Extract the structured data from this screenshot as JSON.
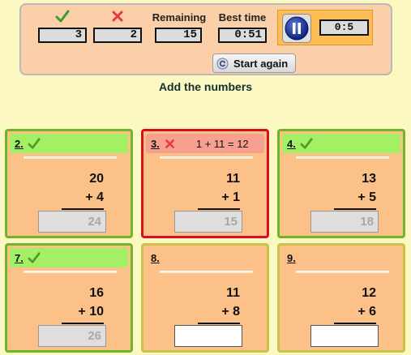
{
  "scoreboard": {
    "correct_count": "3",
    "wrong_count": "2",
    "remaining_label": "Remaining",
    "remaining": "15",
    "best_time_label": "Best time",
    "best_time": "0:51",
    "timer": "0:5",
    "start_again_label": "Start again"
  },
  "colors": {
    "correct": "#6fb52a",
    "wrong": "#d8101d",
    "unanswered": "#cbc24a"
  },
  "instruction": "Add the numbers",
  "problems": [
    {
      "num": "2.",
      "a": "20",
      "b": "+ 4",
      "answer": "24",
      "status": "correct",
      "feedback": ""
    },
    {
      "num": "3.",
      "a": "11",
      "b": "+ 1",
      "answer": "15",
      "status": "wrong",
      "feedback": "1 + 11 = 12"
    },
    {
      "num": "4.",
      "a": "13",
      "b": "+ 5",
      "answer": "18",
      "status": "correct",
      "feedback": ""
    },
    {
      "num": "7.",
      "a": "16",
      "b": "+ 10",
      "answer": "26",
      "status": "correct",
      "feedback": ""
    },
    {
      "num": "8.",
      "a": "11",
      "b": "+ 8",
      "answer": "",
      "status": "unanswered",
      "feedback": ""
    },
    {
      "num": "9.",
      "a": "12",
      "b": "+ 6",
      "answer": "",
      "status": "unanswered",
      "feedback": ""
    }
  ]
}
